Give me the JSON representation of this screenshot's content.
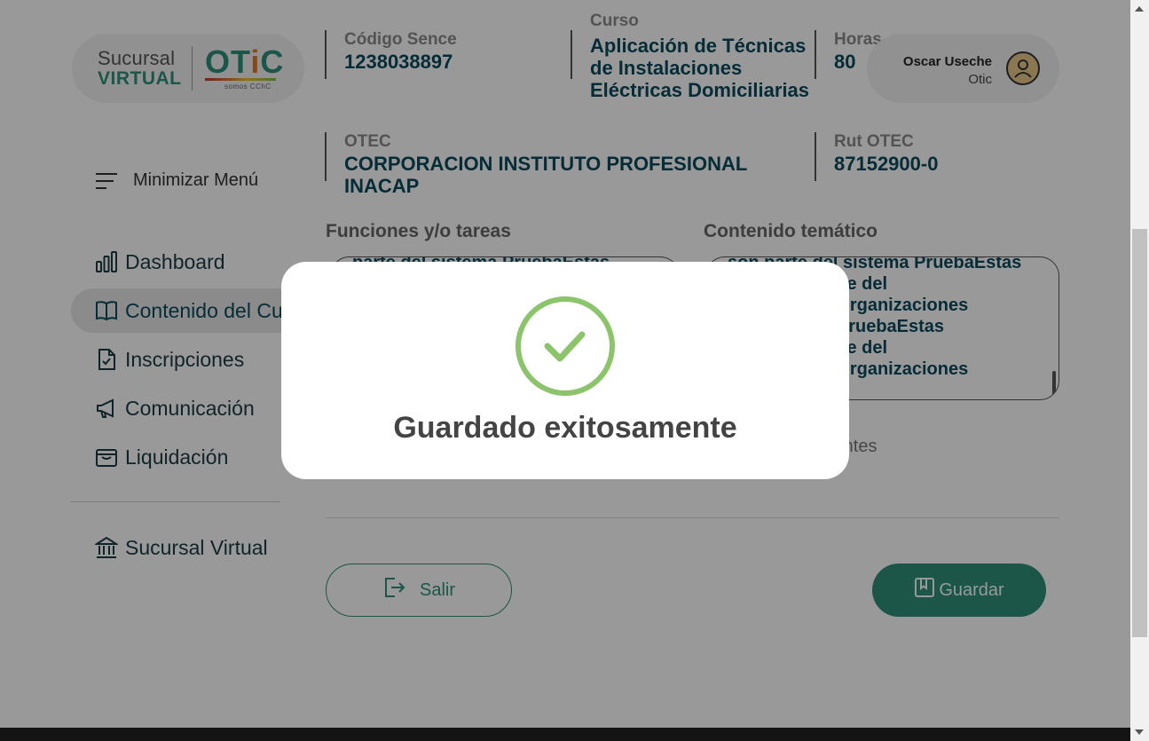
{
  "logo": {
    "line1": "Sucursal",
    "line2": "VIRTUAL",
    "brand_o": "O",
    "brand_t": "T",
    "brand_i": "i",
    "brand_c": "C",
    "tagline": "somos CChC"
  },
  "info": {
    "codigo_label": "Código Sence",
    "codigo_value": "1238038897",
    "curso_label": "Curso",
    "curso_value": "Aplicación de Técnicas de Instalaciones Eléctricas Domiciliarias",
    "horas_label": "Horas",
    "horas_value": "80",
    "otec_label": "OTEC",
    "otec_value": "CORPORACION INSTITUTO PROFESIONAL INACAP",
    "rut_label": "Rut OTEC",
    "rut_value": "87152900-0"
  },
  "user": {
    "name": "Oscar Useche",
    "org": "Otic"
  },
  "sidebar": {
    "minimize_label": "Minimizar Menú",
    "items": [
      {
        "label": "Dashboard"
      },
      {
        "label": "Contenido del Curso"
      },
      {
        "label": "Inscripciones"
      },
      {
        "label": "Comunicación"
      },
      {
        "label": "Liquidación"
      },
      {
        "label": "Sucursal Virtual"
      }
    ]
  },
  "form": {
    "funciones_title": "Funciones y/o tareas",
    "funciones_text": "parte del sistema PruebaEstas",
    "contenido_title": "Contenido temático",
    "contenido_text": "son parte del sistema PruebaEstas\n          son parte del\n          aEstas organizaciones\n          stema\"PruebaEstas\n          son parte del\n          aEstas organizaciones\n          stema\"",
    "helper_text": "nte y los participantes",
    "salir_label": "Salir",
    "guardar_label": "Guardar"
  },
  "modal": {
    "message": "Guardado exitosamente"
  },
  "colors": {
    "accent": "#2d8f7b",
    "dark_teal": "#0b4a5c",
    "success": "#8bc46a"
  }
}
